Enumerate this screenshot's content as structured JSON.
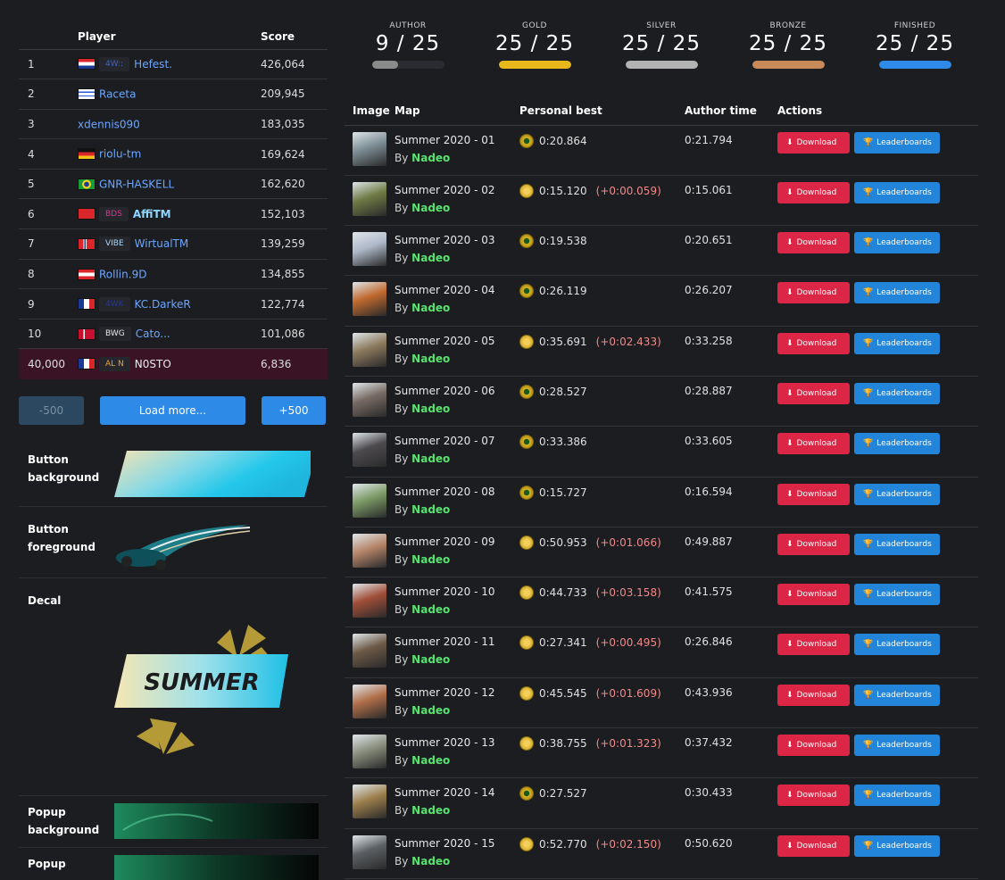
{
  "leaderboard": {
    "headers": {
      "player": "Player",
      "score": "Score"
    },
    "rows": [
      {
        "rank": "1",
        "flag": "hr",
        "tag": "4W::",
        "tag_color": "#3b63d6",
        "player": "Hefest.",
        "score": "426,064",
        "style": "link"
      },
      {
        "rank": "2",
        "flag": "il",
        "tag": "",
        "player": "Raceta",
        "score": "209,945",
        "style": "link"
      },
      {
        "rank": "3",
        "flag": "",
        "tag": "",
        "player": "xdennis090",
        "score": "183,035",
        "style": "link"
      },
      {
        "rank": "4",
        "flag": "de",
        "tag": "",
        "player": "riolu-tm",
        "score": "169,624",
        "style": "link"
      },
      {
        "rank": "5",
        "flag": "br",
        "tag": "",
        "player": "GNR-HASKELL",
        "score": "162,620",
        "style": "link"
      },
      {
        "rank": "6",
        "flag": "ch",
        "tag": "BDS",
        "tag_color": "#e0348e",
        "player": "AffiTM",
        "score": "152,103",
        "style": "bold"
      },
      {
        "rank": "7",
        "flag": "no",
        "tag": "VIBE",
        "tag_color": "#a9d8ff",
        "player": "WirtualTM",
        "score": "139,259",
        "style": "link"
      },
      {
        "rank": "8",
        "flag": "at",
        "tag": "",
        "player": "Rollin.9D",
        "score": "134,855",
        "style": "link"
      },
      {
        "rank": "9",
        "flag": "fr",
        "tag": "4WK",
        "tag_color": "#2138a0",
        "player": "KC.DarkeR",
        "score": "122,774",
        "style": "link"
      },
      {
        "rank": "10",
        "flag": "dk",
        "tag": "BWG",
        "tag_color": "#e6e6e6",
        "player": "Cato...",
        "score": "101,086",
        "style": "link"
      },
      {
        "rank": "40,000",
        "flag": "fr",
        "tag": "AL N",
        "tag_color": "#f2a230",
        "player": "N0STO",
        "score": "6,836",
        "style": "self"
      }
    ],
    "buttons": {
      "prev": "-500",
      "more": "Load more...",
      "next": "+500"
    }
  },
  "assets": [
    {
      "label": "Button background"
    },
    {
      "label": "Button foreground"
    },
    {
      "label": "Decal",
      "decal_text": "SUMMER"
    },
    {
      "label": "Popup background"
    },
    {
      "label": "Popup"
    }
  ],
  "medals": [
    {
      "label": "AUTHOR",
      "value": "9 / 25",
      "progress": 0.36,
      "color": "#8a8a8a"
    },
    {
      "label": "GOLD",
      "value": "25 / 25",
      "progress": 1.0,
      "color": "#e8b71c"
    },
    {
      "label": "SILVER",
      "value": "25 / 25",
      "progress": 1.0,
      "color": "#b3b3b3"
    },
    {
      "label": "BRONZE",
      "value": "25 / 25",
      "progress": 1.0,
      "color": "#c98a5a"
    },
    {
      "label": "FINISHED",
      "value": "25 / 25",
      "progress": 1.0,
      "color": "#2d8ae6"
    }
  ],
  "maps_table": {
    "headers": {
      "image": "Image",
      "map": "Map",
      "pb": "Personal best",
      "author": "Author time",
      "actions": "Actions"
    },
    "by_label": "By",
    "download_label": "Download",
    "leaderboards_label": "Leaderboards",
    "rows": [
      {
        "name": "Summer 2020 - 01",
        "author": "Nadeo",
        "medal": "author",
        "pb": "0:20.864",
        "delta": "",
        "author_time": "0:21.794",
        "thumb": "#7d8e96"
      },
      {
        "name": "Summer 2020 - 02",
        "author": "Nadeo",
        "medal": "gold",
        "pb": "0:15.120",
        "delta": "(+0:00.059)",
        "author_time": "0:15.061",
        "thumb": "#6f7a44"
      },
      {
        "name": "Summer 2020 - 03",
        "author": "Nadeo",
        "medal": "author",
        "pb": "0:19.538",
        "delta": "",
        "author_time": "0:20.651",
        "thumb": "#aeb9c9"
      },
      {
        "name": "Summer 2020 - 04",
        "author": "Nadeo",
        "medal": "author",
        "pb": "0:26.119",
        "delta": "",
        "author_time": "0:26.207",
        "thumb": "#c0692e"
      },
      {
        "name": "Summer 2020 - 05",
        "author": "Nadeo",
        "medal": "gold",
        "pb": "0:35.691",
        "delta": "(+0:02.433)",
        "author_time": "0:33.258",
        "thumb": "#8d7a5e"
      },
      {
        "name": "Summer 2020 - 06",
        "author": "Nadeo",
        "medal": "author",
        "pb": "0:28.527",
        "delta": "",
        "author_time": "0:28.887",
        "thumb": "#786a63"
      },
      {
        "name": "Summer 2020 - 07",
        "author": "Nadeo",
        "medal": "author",
        "pb": "0:33.386",
        "delta": "",
        "author_time": "0:33.605",
        "thumb": "#4d4a4e"
      },
      {
        "name": "Summer 2020 - 08",
        "author": "Nadeo",
        "medal": "author",
        "pb": "0:15.727",
        "delta": "",
        "author_time": "0:16.594",
        "thumb": "#7c9a66"
      },
      {
        "name": "Summer 2020 - 09",
        "author": "Nadeo",
        "medal": "gold",
        "pb": "0:50.953",
        "delta": "(+0:01.066)",
        "author_time": "0:49.887",
        "thumb": "#b7866a"
      },
      {
        "name": "Summer 2020 - 10",
        "author": "Nadeo",
        "medal": "gold",
        "pb": "0:44.733",
        "delta": "(+0:03.158)",
        "author_time": "0:41.575",
        "thumb": "#a04e38"
      },
      {
        "name": "Summer 2020 - 11",
        "author": "Nadeo",
        "medal": "gold",
        "pb": "0:27.341",
        "delta": "(+0:00.495)",
        "author_time": "0:26.846",
        "thumb": "#6d5a47"
      },
      {
        "name": "Summer 2020 - 12",
        "author": "Nadeo",
        "medal": "gold",
        "pb": "0:45.545",
        "delta": "(+0:01.609)",
        "author_time": "0:43.936",
        "thumb": "#b06e49"
      },
      {
        "name": "Summer 2020 - 13",
        "author": "Nadeo",
        "medal": "gold",
        "pb": "0:38.755",
        "delta": "(+0:01.323)",
        "author_time": "0:37.432",
        "thumb": "#8a8f7d"
      },
      {
        "name": "Summer 2020 - 14",
        "author": "Nadeo",
        "medal": "author",
        "pb": "0:27.527",
        "delta": "",
        "author_time": "0:30.433",
        "thumb": "#9c7e4c"
      },
      {
        "name": "Summer 2020 - 15",
        "author": "Nadeo",
        "medal": "gold",
        "pb": "0:52.770",
        "delta": "(+0:02.150)",
        "author_time": "0:50.620",
        "thumb": "#5b5f63"
      }
    ]
  }
}
